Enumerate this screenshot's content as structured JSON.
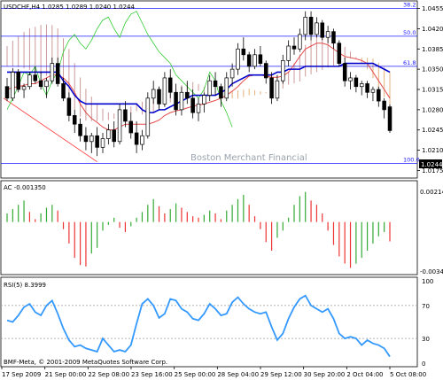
{
  "window": {
    "symbol_header": "USDCHF,H4  1.0285 1.0289 1.0240 1.0244",
    "watermark": "Boston Merchant Financial",
    "copyright": "BMF-Meta, © 2001-2009 MetaQuotes Software Corp.",
    "current_price_label": "1.0244"
  },
  "colors": {
    "bull_candle": "#ffffff",
    "bear_candle": "#000000",
    "kijun": "#0000cc",
    "tenkan": "#e34a4a",
    "chikou": "#33cc33",
    "cloud_a": "#c99",
    "cloud_b": "#e6b07a",
    "fib_line": "#1a1aff",
    "trend_line": "#ff3333",
    "ac_up": "#33aa33",
    "ac_down": "#ee3333",
    "rsi_line": "#3399ff"
  },
  "price_axis": {
    "ticks": [
      "1.0455",
      "1.0420",
      "1.0385",
      "1.0350",
      "1.0315",
      "1.0280",
      "1.0245",
      "1.0210",
      "1.0175"
    ]
  },
  "fib_levels": [
    {
      "label": "38.2",
      "price": 1.0455
    },
    {
      "label": "50.0",
      "price": 1.0407
    },
    {
      "label": "61.8",
      "price": 1.0355
    },
    {
      "label": "100.0",
      "price": 1.0187
    }
  ],
  "ac_panel": {
    "title": "AC -0.001350",
    "ticks": [
      "0.00214",
      "-0.00342"
    ]
  },
  "rsi_panel": {
    "title": "RSI(5) 8.3999",
    "ticks": [
      "100",
      "70",
      "30",
      "0"
    ]
  },
  "time_axis": {
    "labels": [
      "17 Sep 2009",
      "21 Sep 00:00",
      "22 Sep 08:00",
      "23 Sep 16:00",
      "25 Sep 00:00",
      "28 Sep 04:00",
      "29 Sep 12:00",
      "30 Sep 20:00",
      "2 Oct 04:00",
      "5 Oct 08:00"
    ]
  },
  "chart_data": [
    {
      "type": "candlestick",
      "title": "USDCHF,H4",
      "ylim": [
        1.0165,
        1.0465
      ],
      "series": [
        {
          "name": "candles",
          "ohlc": [
            [
              1.032,
              1.0335,
              1.0295,
              1.03
            ],
            [
              1.03,
              1.0352,
              1.0295,
              1.0345
            ],
            [
              1.0345,
              1.035,
              1.031,
              1.0315
            ],
            [
              1.0315,
              1.0325,
              1.03,
              1.032
            ],
            [
              1.032,
              1.0345,
              1.0315,
              1.034
            ],
            [
              1.034,
              1.0355,
              1.0325,
              1.033
            ],
            [
              1.033,
              1.0345,
              1.0315,
              1.032
            ],
            [
              1.032,
              1.0335,
              1.03,
              1.033
            ],
            [
              1.033,
              1.037,
              1.0325,
              1.036
            ],
            [
              1.036,
              1.037,
              1.032,
              1.0325
            ],
            [
              1.0325,
              1.0335,
              1.0295,
              1.03
            ],
            [
              1.03,
              1.031,
              1.026,
              1.027
            ],
            [
              1.027,
              1.028,
              1.024,
              1.0255
            ],
            [
              1.0255,
              1.0265,
              1.0225,
              1.0235
            ],
            [
              1.0235,
              1.025,
              1.021,
              1.0225
            ],
            [
              1.0225,
              1.024,
              1.0205,
              1.0235
            ],
            [
              1.0235,
              1.025,
              1.02,
              1.0215
            ],
            [
              1.0215,
              1.024,
              1.0205,
              1.023
            ],
            [
              1.023,
              1.0255,
              1.022,
              1.0245
            ],
            [
              1.0245,
              1.026,
              1.0215,
              1.0225
            ],
            [
              1.0225,
              1.029,
              1.022,
              1.028
            ],
            [
              1.028,
              1.0295,
              1.025,
              1.026
            ],
            [
              1.026,
              1.0275,
              1.023,
              1.024
            ],
            [
              1.024,
              1.026,
              1.0205,
              1.022
            ],
            [
              1.022,
              1.0245,
              1.021,
              1.0235
            ],
            [
              1.0235,
              1.031,
              1.023,
              1.03
            ],
            [
              1.03,
              1.033,
              1.029,
              1.0315
            ],
            [
              1.0315,
              1.032,
              1.028,
              1.029
            ],
            [
              1.029,
              1.0345,
              1.0285,
              1.0335
            ],
            [
              1.0335,
              1.035,
              1.03,
              1.031
            ],
            [
              1.031,
              1.0325,
              1.027,
              1.028
            ],
            [
              1.028,
              1.032,
              1.027,
              1.031
            ],
            [
              1.031,
              1.033,
              1.029,
              1.03
            ],
            [
              1.03,
              1.0315,
              1.0265,
              1.0275
            ],
            [
              1.0275,
              1.03,
              1.026,
              1.029
            ],
            [
              1.029,
              1.031,
              1.0275,
              1.0305
            ],
            [
              1.0305,
              1.034,
              1.0295,
              1.033
            ],
            [
              1.033,
              1.0345,
              1.0305,
              1.032
            ],
            [
              1.032,
              1.0325,
              1.0285,
              1.03
            ],
            [
              1.03,
              1.0345,
              1.0295,
              1.0335
            ],
            [
              1.0335,
              1.036,
              1.032,
              1.035
            ],
            [
              1.035,
              1.0395,
              1.034,
              1.0385
            ],
            [
              1.0385,
              1.0405,
              1.0365,
              1.0375
            ],
            [
              1.0375,
              1.038,
              1.0345,
              1.0355
            ],
            [
              1.0355,
              1.0385,
              1.035,
              1.0375
            ],
            [
              1.0375,
              1.039,
              1.0355,
              1.036
            ],
            [
              1.036,
              1.0365,
              1.0325,
              1.0335
            ],
            [
              1.0335,
              1.0345,
              1.029,
              1.03
            ],
            [
              1.03,
              1.034,
              1.0295,
              1.033
            ],
            [
              1.033,
              1.0375,
              1.0325,
              1.0365
            ],
            [
              1.0365,
              1.04,
              1.0355,
              1.039
            ],
            [
              1.039,
              1.0405,
              1.0375,
              1.0385
            ],
            [
              1.0385,
              1.042,
              1.038,
              1.041
            ],
            [
              1.041,
              1.045,
              1.04,
              1.044
            ],
            [
              1.044,
              1.045,
              1.04,
              1.041
            ],
            [
              1.041,
              1.044,
              1.0405,
              1.043
            ],
            [
              1.043,
              1.0435,
              1.04,
              1.0405
            ],
            [
              1.0405,
              1.0425,
              1.0395,
              1.0415
            ],
            [
              1.0415,
              1.042,
              1.0385,
              1.0395
            ],
            [
              1.0395,
              1.04,
              1.0355,
              1.036
            ],
            [
              1.036,
              1.037,
              1.032,
              1.033
            ],
            [
              1.033,
              1.0345,
              1.0315,
              1.0335
            ],
            [
              1.0335,
              1.034,
              1.031,
              1.032
            ],
            [
              1.032,
              1.033,
              1.0305,
              1.0325
            ],
            [
              1.0325,
              1.033,
              1.03,
              1.031
            ],
            [
              1.031,
              1.032,
              1.0295,
              1.0315
            ],
            [
              1.0315,
              1.032,
              1.0285,
              1.0295
            ],
            [
              1.0295,
              1.03,
              1.0265,
              1.028
            ],
            [
              1.0285,
              1.0289,
              1.024,
              1.0244
            ]
          ]
        },
        {
          "name": "Kijun-sen",
          "values": [
            1.0345,
            1.0345,
            1.0345,
            1.0345,
            1.0345,
            1.0345,
            1.0345,
            1.0345,
            1.0345,
            1.0345,
            1.033,
            1.032,
            1.0305,
            1.0295,
            1.029,
            1.029,
            1.029,
            1.029,
            1.029,
            1.029,
            1.029,
            1.029,
            1.029,
            1.029,
            1.028,
            1.0275,
            1.0275,
            1.028,
            1.028,
            1.0285,
            1.029,
            1.0295,
            1.03,
            1.0305,
            1.0305,
            1.0305,
            1.0305,
            1.0305,
            1.031,
            1.0315,
            1.0325,
            1.033,
            1.0335,
            1.034,
            1.034,
            1.034,
            1.034,
            1.034,
            1.0345,
            1.0345,
            1.035,
            1.035,
            1.035,
            1.0355,
            1.0355,
            1.0355,
            1.0355,
            1.0355,
            1.0355,
            1.0355,
            1.036,
            1.036,
            1.036,
            1.036,
            1.036,
            1.036,
            1.0355,
            1.035,
            1.0345
          ]
        },
        {
          "name": "Tenkan-sen",
          "values": [
            1.0315,
            1.0318,
            1.032,
            1.0322,
            1.0325,
            1.0325,
            1.033,
            1.0335,
            1.034,
            1.034,
            1.0335,
            1.0325,
            1.031,
            1.029,
            1.0275,
            1.0265,
            1.0258,
            1.025,
            1.0245,
            1.0245,
            1.025,
            1.0255,
            1.0255,
            1.0255,
            1.0255,
            1.0255,
            1.0258,
            1.0262,
            1.027,
            1.0275,
            1.0278,
            1.028,
            1.0283,
            1.0286,
            1.0288,
            1.029,
            1.0293,
            1.0296,
            1.03,
            1.0305,
            1.0312,
            1.032,
            1.033,
            1.0338,
            1.034,
            1.034,
            1.0338,
            1.0336,
            1.0336,
            1.0338,
            1.0345,
            1.0358,
            1.0372,
            1.0385,
            1.039,
            1.0395,
            1.0395,
            1.0392,
            1.0385,
            1.0378,
            1.0372,
            1.037,
            1.0368,
            1.0365,
            1.036,
            1.0345,
            1.033,
            1.0315,
            1.03
          ]
        },
        {
          "name": "Chikou",
          "values": [
            1.028,
            1.03,
            1.032,
            1.0345,
            1.034,
            1.0355,
            1.0325,
            1.0305,
            1.033,
            1.0345,
            1.038,
            1.04,
            1.041,
            1.0395,
            1.0385,
            1.04,
            1.042,
            1.0435,
            1.044,
            1.042,
            1.0405,
            1.043,
            1.0445,
            1.045,
            1.043,
            1.041,
            1.0395,
            1.038,
            1.037,
            1.036,
            1.034,
            1.033,
            1.032,
            1.031,
            1.03,
            1.0315,
            1.0345,
            1.033,
            1.0295,
            1.0275,
            1.025
          ]
        },
        {
          "name": "AC",
          "values": [
            0.0006,
            0.0009,
            0.0012,
            0.0015,
            0.0007,
            0.0002,
            0.0006,
            0.001,
            0.0012,
            0.0008,
            -0.0005,
            -0.0015,
            -0.0025,
            -0.003,
            -0.0031,
            -0.0022,
            -0.0018,
            -0.0006,
            -0.0002,
            0.0003,
            -0.0004,
            -0.0007,
            -0.0003,
            0.0003,
            0.0007,
            0.0012,
            0.0016,
            0.0011,
            0.0006,
            0.0009,
            0.0013,
            0.001,
            0.0007,
            0.0004,
            0.0003,
            0.0005,
            0.0008,
            0.0006,
            0.0002,
            0.0008,
            0.0012,
            0.0016,
            0.0019,
            0.0012,
            0.0004,
            -0.0005,
            -0.0014,
            -0.002,
            -0.0011,
            -0.0006,
            0.0003,
            0.0012,
            0.0018,
            0.0021,
            0.0015,
            0.0012,
            0.0006,
            -0.0006,
            -0.0016,
            -0.0024,
            -0.0029,
            -0.0032,
            -0.0029,
            -0.0025,
            -0.002,
            -0.0015,
            -0.001,
            -0.0007,
            -0.00135
          ]
        },
        {
          "name": "RSI(5)",
          "values": [
            52,
            50,
            58,
            68,
            72,
            62,
            58,
            70,
            76,
            60,
            42,
            28,
            20,
            22,
            18,
            16,
            14,
            30,
            22,
            14,
            16,
            14,
            22,
            48,
            72,
            78,
            70,
            55,
            60,
            78,
            76,
            66,
            62,
            54,
            52,
            60,
            72,
            66,
            58,
            60,
            74,
            80,
            72,
            66,
            62,
            60,
            62,
            44,
            28,
            36,
            54,
            68,
            78,
            82,
            70,
            66,
            62,
            66,
            54,
            36,
            30,
            32,
            30,
            22,
            28,
            24,
            22,
            18,
            8
          ]
        }
      ]
    }
  ]
}
